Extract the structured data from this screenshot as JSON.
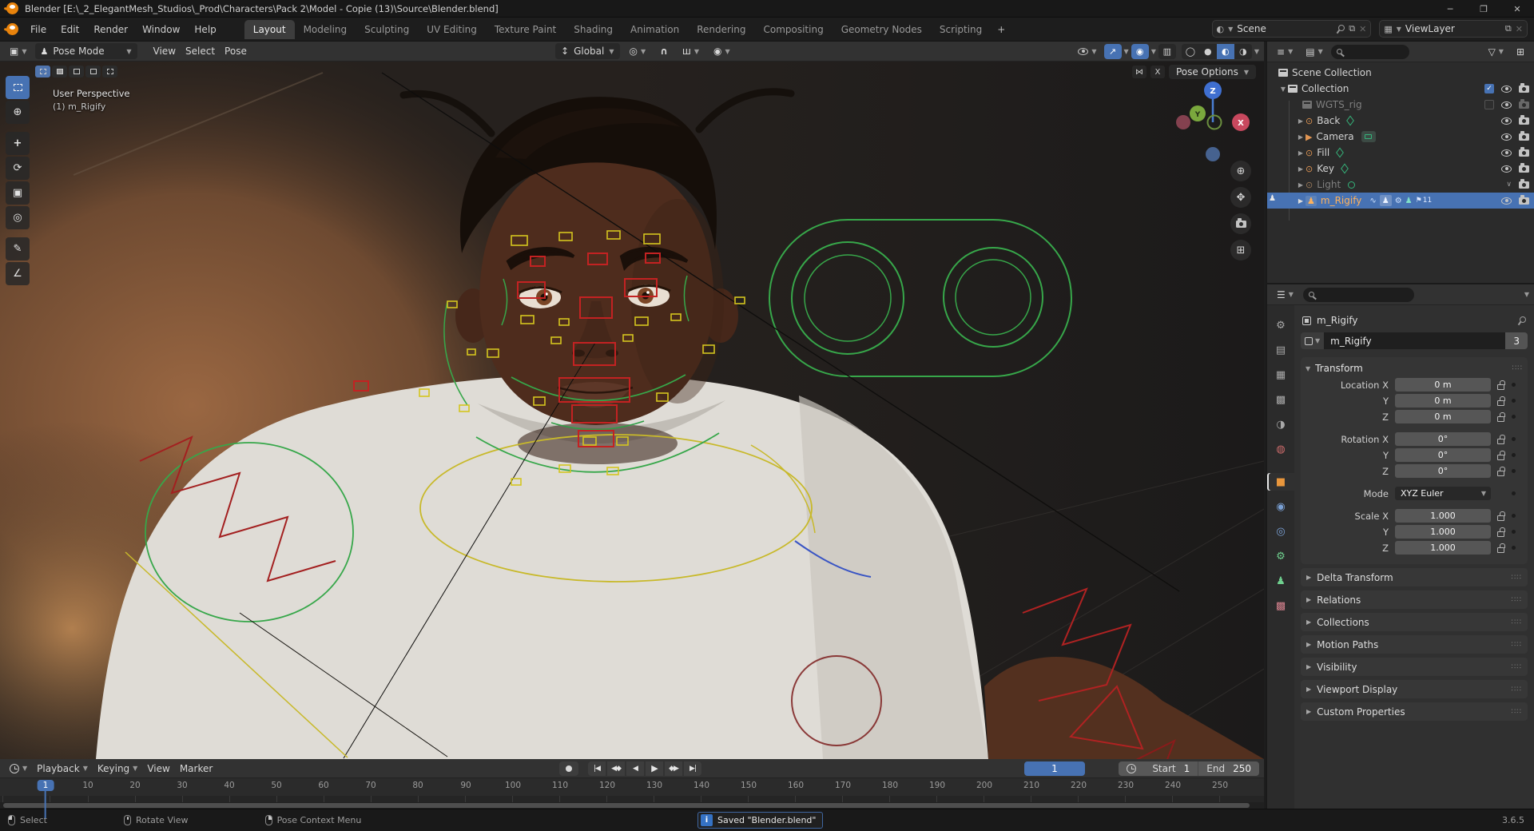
{
  "titlebar": {
    "title": "Blender [E:\\_2_ElegantMesh_Studios\\_Prod\\Characters\\Pack 2\\Model - Copie (13)\\Source\\Blender.blend]"
  },
  "topbar": {
    "menus": [
      "File",
      "Edit",
      "Render",
      "Window",
      "Help"
    ],
    "workspaces": [
      "Layout",
      "Modeling",
      "Sculpting",
      "UV Editing",
      "Texture Paint",
      "Shading",
      "Animation",
      "Rendering",
      "Compositing",
      "Geometry Nodes",
      "Scripting"
    ],
    "active_workspace": "Layout",
    "add_workspace": "+",
    "scene": {
      "label": "Scene"
    },
    "view_layer": {
      "label": "ViewLayer"
    }
  },
  "viewport_header": {
    "mode": "Pose Mode",
    "menus": [
      "View",
      "Select",
      "Pose"
    ],
    "orientation": "Global",
    "mirror_x": "X",
    "pose_options": "Pose Options"
  },
  "viewport": {
    "view_label": "User Perspective",
    "object_label": "(1) m_Rigify",
    "axis": {
      "x": "X",
      "y": "Y",
      "z": "Z"
    }
  },
  "outliner": {
    "rows": [
      {
        "label": "Scene Collection"
      },
      {
        "label": "Collection"
      },
      {
        "label": "WGTS_rig"
      },
      {
        "label": "Back"
      },
      {
        "label": "Camera"
      },
      {
        "label": "Fill"
      },
      {
        "label": "Key"
      },
      {
        "label": "Light"
      },
      {
        "label": "m_Rigify",
        "badge": "11"
      }
    ]
  },
  "properties": {
    "breadcrumb": "m_Rigify",
    "datablock": "m_Rigify",
    "users_count": "3",
    "transform": {
      "title": "Transform",
      "rows": [
        {
          "label": "Location X",
          "value": "0 m"
        },
        {
          "label": "Y",
          "value": "0 m"
        },
        {
          "label": "Z",
          "value": "0 m"
        },
        {
          "label": "Rotation X",
          "value": "0°"
        },
        {
          "label": "Y",
          "value": "0°"
        },
        {
          "label": "Z",
          "value": "0°"
        },
        {
          "label": "Mode",
          "value": "XYZ Euler"
        },
        {
          "label": "Scale X",
          "value": "1.000"
        },
        {
          "label": "Y",
          "value": "1.000"
        },
        {
          "label": "Z",
          "value": "1.000"
        }
      ]
    },
    "sections": [
      "Delta Transform",
      "Relations",
      "Collections",
      "Motion Paths",
      "Visibility",
      "Viewport Display",
      "Custom Properties"
    ]
  },
  "timeline": {
    "menus": [
      "Playback",
      "Keying",
      "View",
      "Marker"
    ],
    "current_frame": "1",
    "start_label": "Start",
    "start_value": "1",
    "end_label": "End",
    "end_value": "250",
    "ruler": [
      "1",
      "10",
      "20",
      "30",
      "40",
      "50",
      "60",
      "70",
      "80",
      "90",
      "100",
      "110",
      "120",
      "130",
      "140",
      "150",
      "160",
      "170",
      "180",
      "190",
      "200",
      "210",
      "220",
      "230",
      "240",
      "250"
    ]
  },
  "statusbar": {
    "items": [
      "Select",
      "Rotate View",
      "Pose Context Menu"
    ],
    "message": "Saved \"Blender.blend\"",
    "version": "3.6.5"
  },
  "colors": {
    "accent": "#4772b3",
    "blender_orange": "#e8830c",
    "selected_label": "#ffb25c",
    "widget_green": "#37a74a",
    "widget_yellow": "#c8b92a",
    "widget_red": "#c32222"
  }
}
